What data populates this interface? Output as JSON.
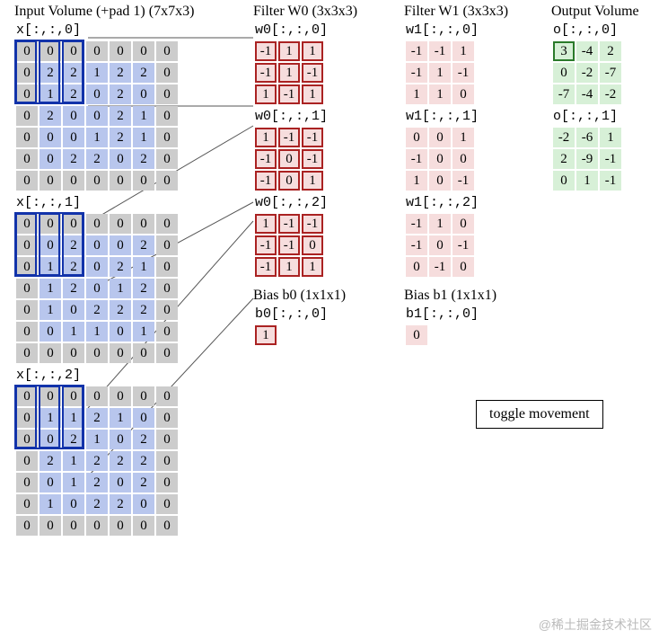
{
  "headings": {
    "input": "Input Volume (+pad 1) (7x7x3)",
    "filter0": "Filter W0 (3x3x3)",
    "filter1": "Filter W1 (3x3x3)",
    "output": "Output Volume",
    "bias0": "Bias b0 (1x1x1)",
    "bias1": "Bias b1 (1x1x1)"
  },
  "labels": {
    "x0": "x[:,:,0]",
    "x1": "x[:,:,1]",
    "x2": "x[:,:,2]",
    "w00": "w0[:,:,0]",
    "w01": "w0[:,:,1]",
    "w02": "w0[:,:,2]",
    "w10": "w1[:,:,0]",
    "w11": "w1[:,:,1]",
    "w12": "w1[:,:,2]",
    "b0": "b0[:,:,0]",
    "b1": "b1[:,:,0]",
    "o0": "o[:,:,0]",
    "o1": "o[:,:,1]"
  },
  "X": [
    [
      [
        0,
        0,
        0,
        0,
        0,
        0,
        0
      ],
      [
        0,
        2,
        2,
        1,
        2,
        2,
        0
      ],
      [
        0,
        1,
        2,
        0,
        2,
        0,
        0
      ],
      [
        0,
        2,
        0,
        0,
        2,
        1,
        0
      ],
      [
        0,
        0,
        0,
        1,
        2,
        1,
        0
      ],
      [
        0,
        0,
        2,
        2,
        0,
        2,
        0
      ],
      [
        0,
        0,
        0,
        0,
        0,
        0,
        0
      ]
    ],
    [
      [
        0,
        0,
        0,
        0,
        0,
        0,
        0
      ],
      [
        0,
        0,
        2,
        0,
        0,
        2,
        0
      ],
      [
        0,
        1,
        2,
        0,
        2,
        1,
        0
      ],
      [
        0,
        1,
        2,
        0,
        1,
        2,
        0
      ],
      [
        0,
        1,
        0,
        2,
        2,
        2,
        0
      ],
      [
        0,
        0,
        1,
        1,
        0,
        1,
        0
      ],
      [
        0,
        0,
        0,
        0,
        0,
        0,
        0
      ]
    ],
    [
      [
        0,
        0,
        0,
        0,
        0,
        0,
        0
      ],
      [
        0,
        1,
        1,
        2,
        1,
        0,
        0
      ],
      [
        0,
        0,
        2,
        1,
        0,
        2,
        0
      ],
      [
        0,
        2,
        1,
        2,
        2,
        2,
        0
      ],
      [
        0,
        0,
        1,
        2,
        0,
        2,
        0
      ],
      [
        0,
        1,
        0,
        2,
        2,
        0,
        0
      ],
      [
        0,
        0,
        0,
        0,
        0,
        0,
        0
      ]
    ]
  ],
  "W0": [
    [
      [
        -1,
        1,
        1
      ],
      [
        -1,
        1,
        -1
      ],
      [
        1,
        -1,
        1
      ]
    ],
    [
      [
        1,
        -1,
        -1
      ],
      [
        -1,
        0,
        -1
      ],
      [
        -1,
        0,
        1
      ]
    ],
    [
      [
        1,
        -1,
        -1
      ],
      [
        -1,
        -1,
        0
      ],
      [
        -1,
        1,
        1
      ]
    ]
  ],
  "W1": [
    [
      [
        -1,
        -1,
        1
      ],
      [
        -1,
        1,
        -1
      ],
      [
        1,
        1,
        0
      ]
    ],
    [
      [
        0,
        0,
        1
      ],
      [
        -1,
        0,
        0
      ],
      [
        1,
        0,
        -1
      ]
    ],
    [
      [
        -1,
        1,
        0
      ],
      [
        -1,
        0,
        -1
      ],
      [
        0,
        -1,
        0
      ]
    ]
  ],
  "b0": [
    [
      1
    ]
  ],
  "b1": [
    [
      0
    ]
  ],
  "O": [
    [
      [
        3,
        -4,
        2
      ],
      [
        0,
        -2,
        -7
      ],
      [
        -7,
        -4,
        -2
      ]
    ],
    [
      [
        -2,
        -6,
        1
      ],
      [
        2,
        -9,
        -1
      ],
      [
        0,
        1,
        -1
      ]
    ]
  ],
  "activeOutput": {
    "channel": 0,
    "row": 0,
    "col": 0
  },
  "inputWindow": {
    "row": 0,
    "col": 0,
    "size": 3
  },
  "button": "toggle movement",
  "watermark": "@稀土掘金技术社区"
}
